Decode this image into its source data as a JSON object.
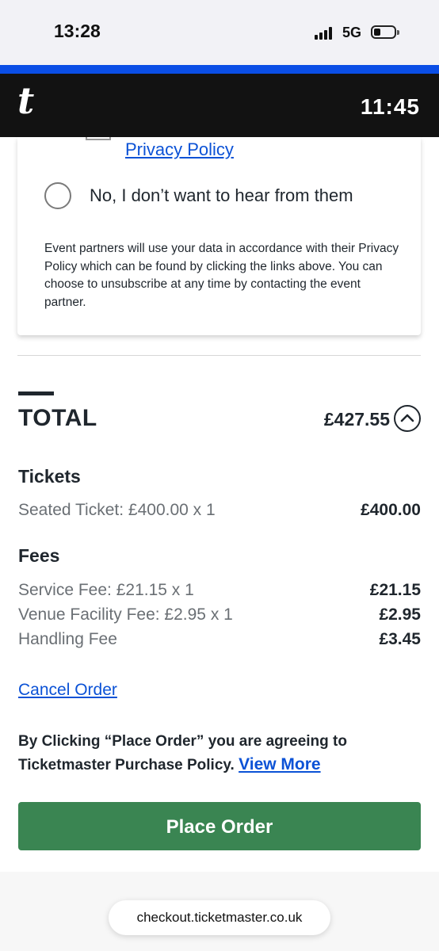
{
  "status_bar": {
    "time": "13:28",
    "network": "5G",
    "battery_level": 0.2
  },
  "app_bar": {
    "logo": "t",
    "countdown": "11:45"
  },
  "consent": {
    "privacy_link": "Privacy Policy",
    "radio_no_label": "No, I don’t want to hear from them",
    "note": "Event partners will use your data in accordance with their Privacy Policy which can be found by clicking the links above. You can choose to unsubscribe at any time by contacting the event partner."
  },
  "order": {
    "total_label": "TOTAL",
    "total_amount": "£427.55",
    "tickets_heading": "Tickets",
    "tickets": [
      {
        "label": "Seated Ticket: £400.00 x 1",
        "value": "£400.00"
      }
    ],
    "fees_heading": "Fees",
    "fees": [
      {
        "label": "Service Fee: £21.15 x 1",
        "value": "£21.15"
      },
      {
        "label": "Venue Facility Fee: £2.95 x 1",
        "value": "£2.95"
      },
      {
        "label": "Handling Fee",
        "value": "£3.45"
      }
    ],
    "cancel_label": "Cancel Order",
    "agreement_text": "By Clicking “Place Order” you are agreeing to Ticketmaster Purchase Policy.",
    "view_more_label": "View More",
    "place_order_label": "Place Order"
  },
  "browser": {
    "url": "checkout.ticketmaster.co.uk"
  },
  "colors": {
    "accent_blue": "#0a4ee6",
    "link_blue": "#0b52d6",
    "place_order_green": "#3a8552",
    "app_bar": "#121212"
  }
}
